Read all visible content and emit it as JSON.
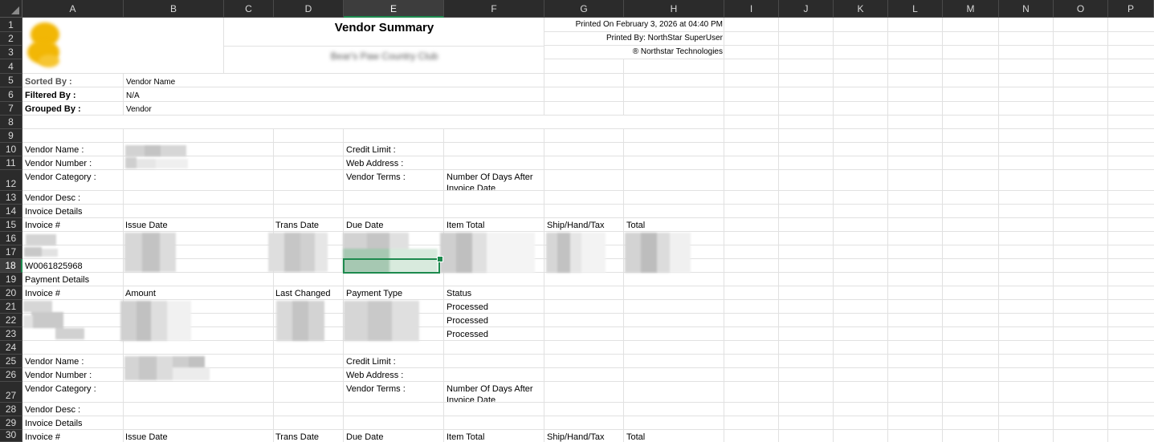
{
  "columns": [
    "A",
    "B",
    "C",
    "D",
    "E",
    "F",
    "G",
    "H",
    "I",
    "J",
    "K",
    "L",
    "M",
    "N",
    "O",
    "P"
  ],
  "rows": [
    "1",
    "2",
    "3",
    "4",
    "5",
    "6",
    "7",
    "8",
    "9",
    "10",
    "11",
    "12",
    "13",
    "14",
    "15",
    "16",
    "17",
    "18",
    "19",
    "20",
    "21",
    "22",
    "23",
    "24",
    "25",
    "26",
    "27",
    "28",
    "29",
    "30"
  ],
  "selected_column": "E",
  "selected_row": "18",
  "header": {
    "title": "Vendor Summary",
    "subtitle": "Bear's Paw Country Club",
    "printed_on": "Printed On February 3, 2026 at 04:40 PM",
    "printed_by": "Printed By: NorthStar SuperUser",
    "company": "® Northstar Technologies"
  },
  "meta": {
    "sorted_label": "Sorted By :",
    "sorted_value": "Vendor Name",
    "filtered_label": "Filtered By :",
    "filtered_value": "N/A",
    "grouped_label": "Grouped By :",
    "grouped_value": "Vendor"
  },
  "vendor_block_1": {
    "name_label": "Vendor Name :",
    "number_label": "Vendor Number :",
    "category_label": "Vendor Category :",
    "desc_label": "Vendor Desc :",
    "credit_label": "Credit Limit :",
    "web_label": "Web Address :",
    "terms_label": "Vendor Terms :",
    "terms_value": "Number Of Days After Invoice Date"
  },
  "invoice_section": {
    "title": "Invoice Details",
    "headers": [
      "Invoice #",
      "Issue Date",
      "Trans Date",
      "Due Date",
      "Item Total",
      "Ship/Hand/Tax",
      "Total"
    ],
    "visible_invoice": "W0061825968"
  },
  "payment_section": {
    "title": "Payment Details",
    "headers": [
      "Invoice #",
      "Amount",
      "Last Changed",
      "Payment Type",
      "Status"
    ],
    "statuses": [
      "Processed",
      "Processed",
      "Processed"
    ]
  },
  "vendor_block_2": {
    "name_label": "Vendor Name :",
    "number_label": "Vendor Number :",
    "category_label": "Vendor Category :",
    "desc_label": "Vendor Desc :",
    "credit_label": "Credit Limit :",
    "web_label": "Web Address :",
    "terms_label": "Vendor Terms :",
    "terms_value": "Number Of Days After Invoice Date"
  },
  "invoice_section_2": {
    "title": "Invoice Details",
    "headers": [
      "Invoice #",
      "Issue Date",
      "Trans Date",
      "Due Date",
      "Item Total",
      "Ship/Hand/Tax",
      "Total"
    ]
  },
  "colors": {
    "header_bg": "#2b2b2b",
    "header_text": "#d8d8d8",
    "gridline": "#e1e1e1",
    "selection": "#1d8a4e",
    "logo": "#f2b705"
  }
}
